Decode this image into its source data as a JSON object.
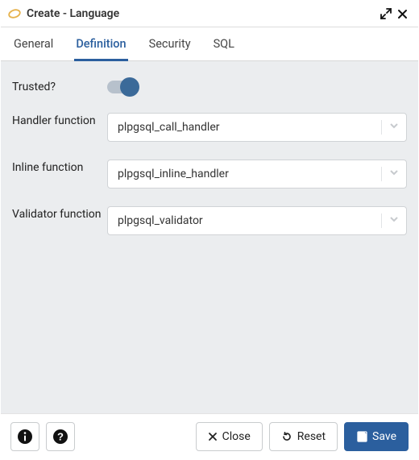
{
  "window": {
    "title": "Create - Language"
  },
  "tabs": {
    "general": "General",
    "definition": "Definition",
    "security": "Security",
    "sql": "SQL",
    "active": "definition"
  },
  "form": {
    "trusted": {
      "label": "Trusted?",
      "value": true
    },
    "handler": {
      "label": "Handler function",
      "value": "plpgsql_call_handler"
    },
    "inline": {
      "label": "Inline function",
      "value": "plpgsql_inline_handler"
    },
    "validator": {
      "label": "Validator function",
      "value": "plpgsql_validator"
    }
  },
  "footer": {
    "close": "Close",
    "reset": "Reset",
    "save": "Save"
  }
}
